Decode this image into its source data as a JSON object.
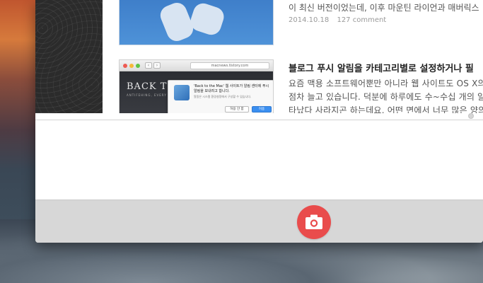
{
  "post_1": {
    "excerpt": "이 최신 버전이었는데, 이후 마운틴 라이언과 매버릭스",
    "date": "2014.10.18",
    "comments": "127 comment"
  },
  "post_2": {
    "title": "블로그 푸시 알림을 카테고리별로 설정하거나 필",
    "lines": [
      "요즘 맥용 소프트웨어뿐만 아니라 웹 사이트도 OS X의",
      "점차 늘고 있습니다. 덕분에 하루에도 수~수십 개의 알",
      "타났다 사라지곤 하는데요, 어떤 면에서 너무 많은 양의"
    ],
    "thumbnail": {
      "url": "macnews.tistory.com",
      "brand": "BACK T",
      "tagline": "ANTIFEHING, EVERY",
      "dialog_title": "'Back to the Mac' 웹 사이트가 알림 센터에 푸시 알림을 보내려고 합니다.",
      "dialog_body": "알림은 시스템 환경설정에서 구성할 수 있습니다.",
      "deny_label": "허용 안 함",
      "allow_label": "허용"
    }
  },
  "toolbar": {
    "capture_icon": "camera-icon",
    "capture_color": "#e94c4c"
  }
}
